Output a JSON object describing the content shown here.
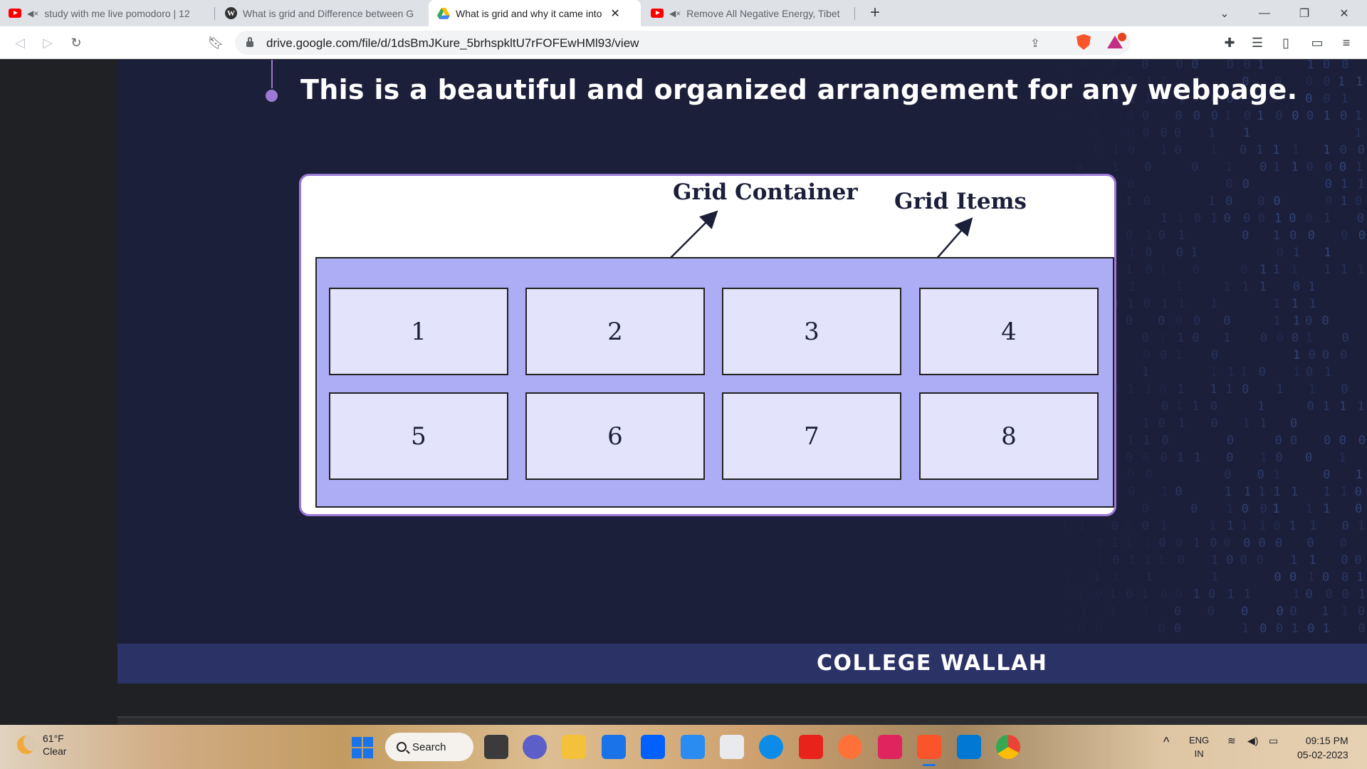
{
  "browser": {
    "tabs": [
      {
        "title": "study with me live pomodoro | 12",
        "favicon": "youtube-icon",
        "muted": true
      },
      {
        "title": "What is grid and Difference between G",
        "favicon": "wordpress-icon",
        "muted": false
      },
      {
        "title": "What is grid and why it came into",
        "favicon": "google-drive-icon",
        "muted": false,
        "active": true
      },
      {
        "title": "Remove All Negative Energy, Tibet",
        "favicon": "youtube-icon",
        "muted": true
      }
    ],
    "new_tab_label": "+",
    "url": "drive.google.com/file/d/1dsBmJKure_5brhspkltU7rFOFEwHMl93/view"
  },
  "slide": {
    "headline": "This is a beautiful and organized arrangement for any webpage.",
    "diagram": {
      "label_container": "Grid Container",
      "label_items": "Grid Items",
      "items": [
        "1",
        "2",
        "3",
        "4",
        "5",
        "6",
        "7",
        "8"
      ]
    },
    "brand": "COLLEGE WALLAH"
  },
  "taskbar": {
    "weather_temp": "61°F",
    "weather_cond": "Clear",
    "search_label": "Search",
    "lang_line1": "ENG",
    "lang_line2": "IN",
    "time": "09:15 PM",
    "date": "05-02-2023"
  },
  "colors": {
    "slide_bg": "#1c1f3a",
    "accent_purple": "#9b7ad6",
    "grid_container": "#adadf5",
    "grid_item": "#e3e3fb",
    "footer": "#2b3266"
  }
}
